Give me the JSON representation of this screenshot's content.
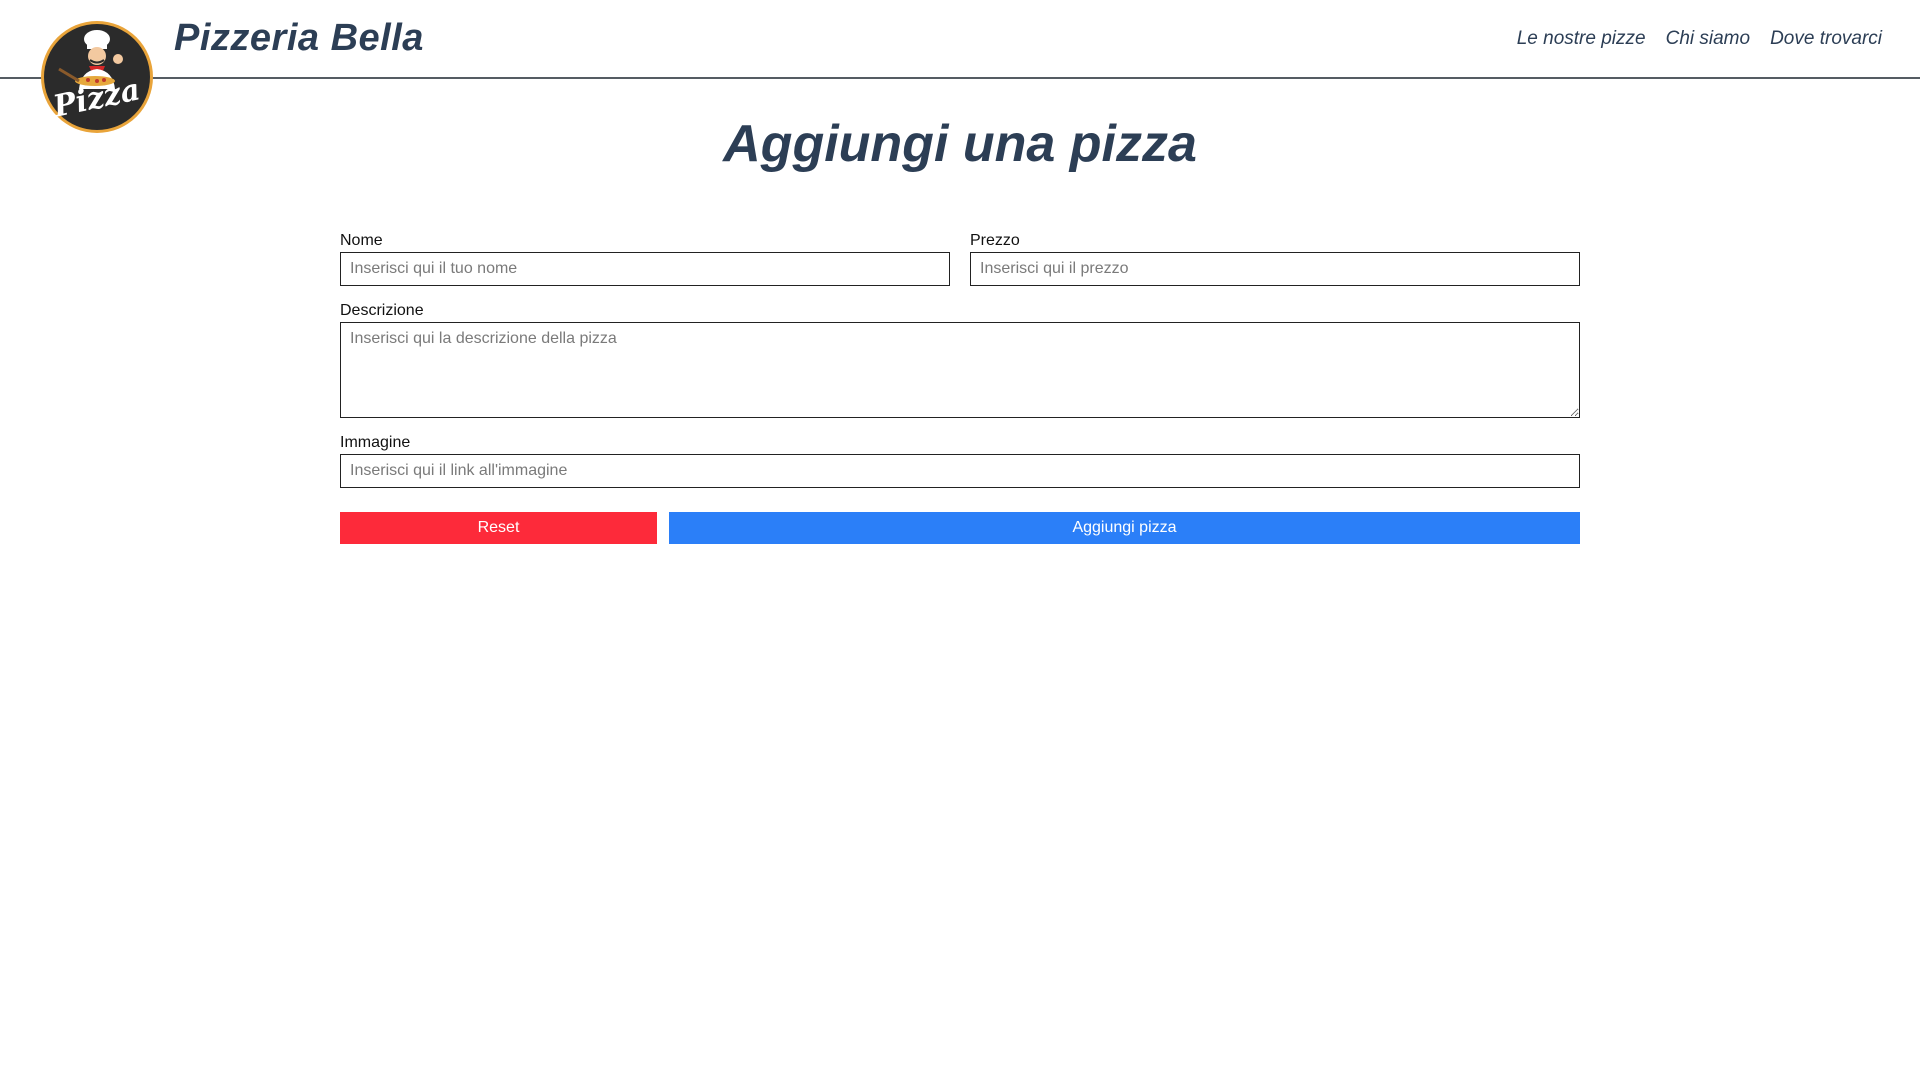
{
  "header": {
    "brand": "Pizzeria Bella",
    "logo_text": "Pizza",
    "nav": [
      "Le nostre pizze",
      "Chi siamo",
      "Dove trovarci"
    ]
  },
  "main": {
    "title": "Aggiungi una pizza",
    "fields": {
      "nome": {
        "label": "Nome",
        "placeholder": "Inserisci qui il tuo nome",
        "value": ""
      },
      "prezzo": {
        "label": "Prezzo",
        "placeholder": "Inserisci qui il prezzo",
        "value": ""
      },
      "descrizione": {
        "label": "Descrizione",
        "placeholder": "Inserisci qui la descrizione della pizza",
        "value": ""
      },
      "immagine": {
        "label": "Immagine",
        "placeholder": "Inserisci qui il link all'immagine",
        "value": ""
      }
    },
    "buttons": {
      "reset": "Reset",
      "add": "Aggiungi pizza"
    }
  },
  "colors": {
    "brand": "#2c3e55",
    "reset": "#fd2a3a",
    "add": "#2b7ff8",
    "logo_ring": "#e9a43a",
    "logo_bg": "#2b2b2b"
  }
}
